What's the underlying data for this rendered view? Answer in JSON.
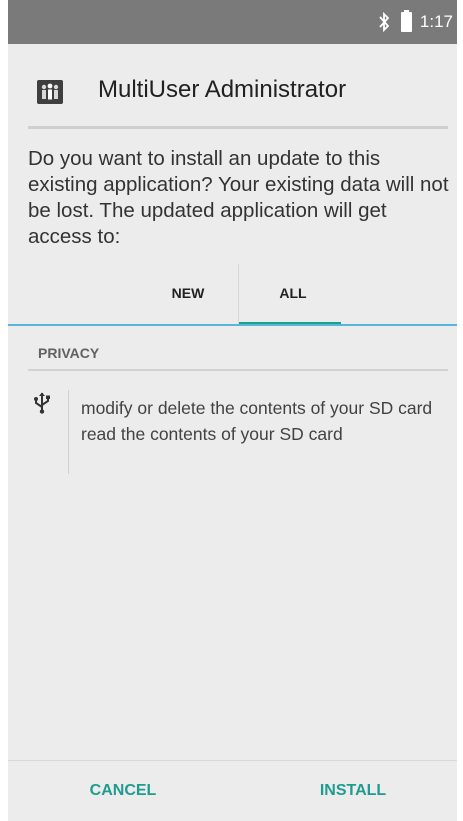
{
  "status_bar": {
    "time": "1:17",
    "icons": [
      "bluetooth-icon",
      "battery-icon"
    ]
  },
  "header": {
    "app_title": "MultiUser Administrator",
    "icon": "multiuser-app-icon"
  },
  "message": "Do you want to install an update to this existing application? Your existing data will not be lost. The updated application will get access to:",
  "tabs": [
    {
      "label": "NEW",
      "selected": false
    },
    {
      "label": "ALL",
      "selected": true
    }
  ],
  "section": {
    "title": "PRIVACY",
    "icon": "usb-icon",
    "permissions": [
      "modify or delete the contents of your SD card",
      "read the contents of your SD card"
    ]
  },
  "buttons": {
    "cancel": "CANCEL",
    "install": "INSTALL"
  },
  "colors": {
    "accent": "#1f9c8f",
    "tab_indicator": "#19a08f",
    "divider_blue": "#55b6de",
    "status_bar": "#7a7a7a",
    "background": "#ececec"
  }
}
